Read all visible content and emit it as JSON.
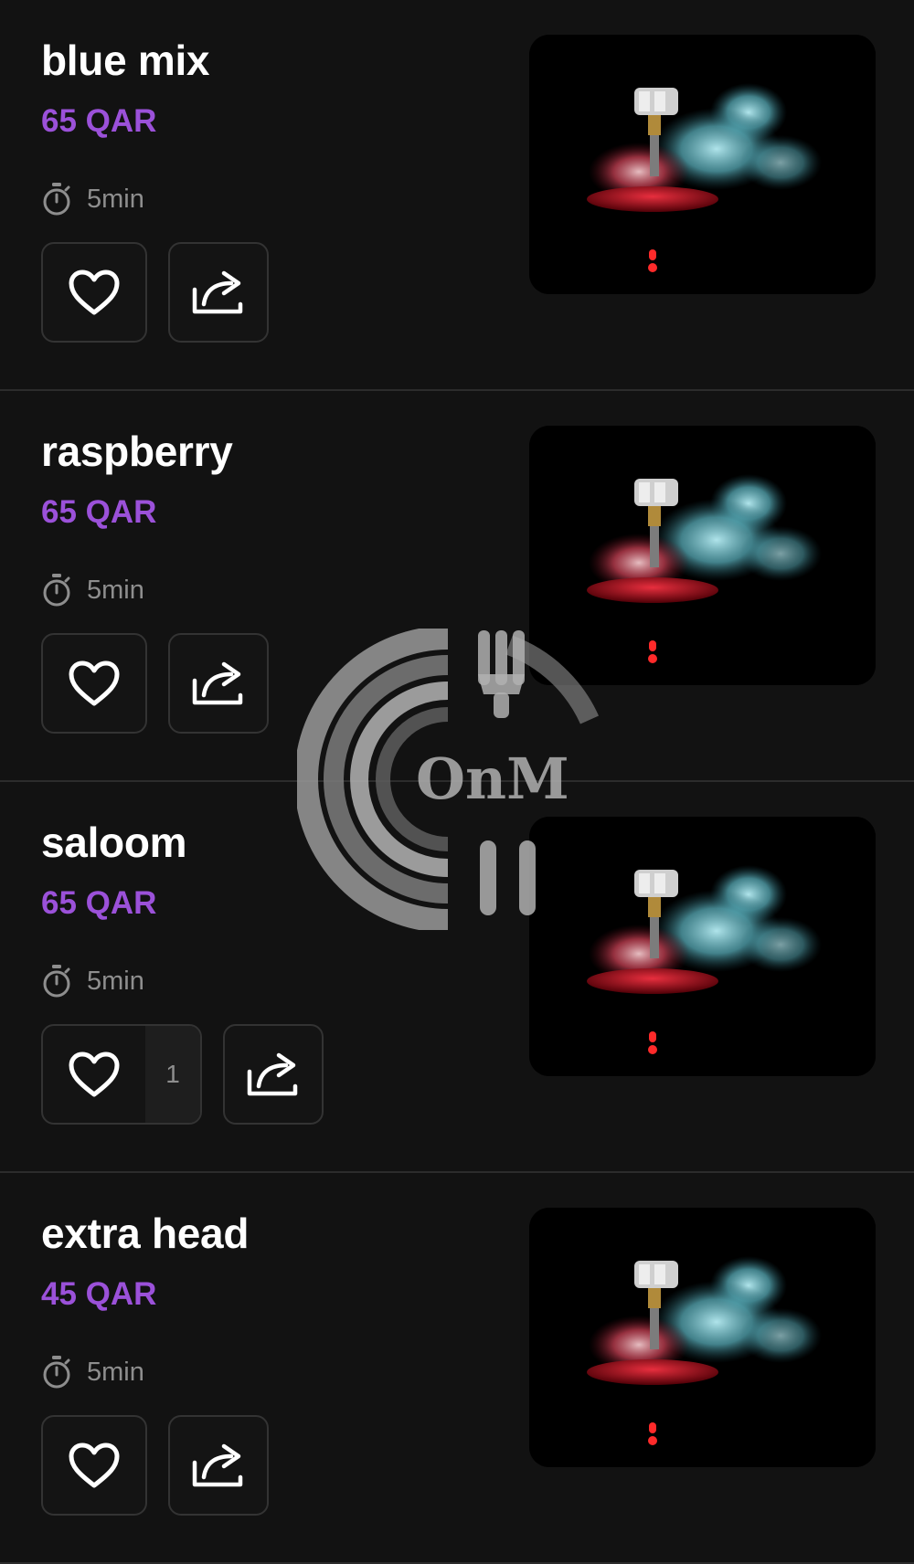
{
  "items": [
    {
      "name": "blue mix",
      "price": "65 QAR",
      "time": "5min",
      "likes": ""
    },
    {
      "name": "raspberry",
      "price": "65 QAR",
      "time": "5min",
      "likes": ""
    },
    {
      "name": "saloom",
      "price": "65 QAR",
      "time": "5min",
      "likes": "1"
    },
    {
      "name": "extra head",
      "price": "45 QAR",
      "time": "5min",
      "likes": ""
    }
  ],
  "icons": {
    "time": "stopwatch-icon",
    "like": "heart-icon",
    "share": "share-icon"
  },
  "watermark": {
    "text": "OnM"
  },
  "colors": {
    "background": "#121212",
    "price": "#9b51d9",
    "muted": "#8e8e8e",
    "border": "#333333"
  }
}
